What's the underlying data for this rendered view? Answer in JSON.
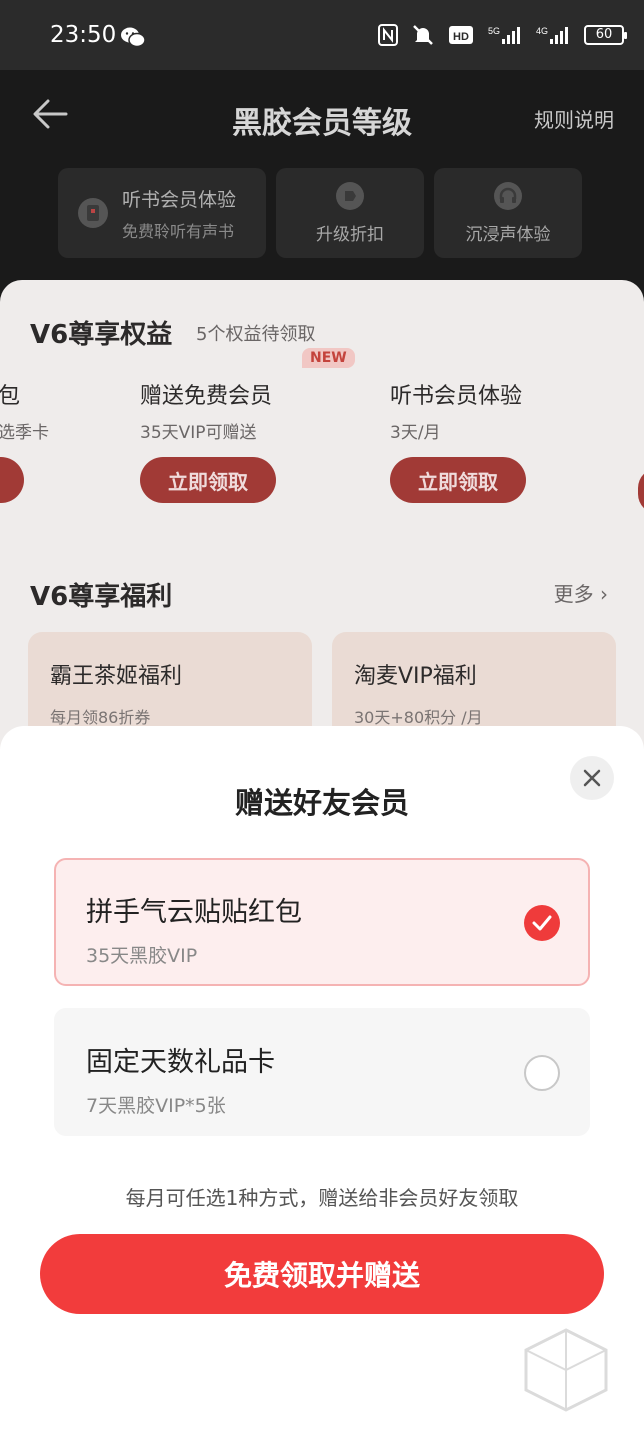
{
  "status_bar": {
    "time": "23:50",
    "battery": "60",
    "icons": [
      "wechat-icon",
      "nfc-icon",
      "mute-icon",
      "hd-icon",
      "5g-signal-icon",
      "4g-signal-icon",
      "battery-icon"
    ]
  },
  "header": {
    "title": "黑胶会员等级",
    "rules_label": "规则说明",
    "tabs": [
      {
        "label": "听书会员体验",
        "sub": "免费聆听有声书",
        "icon": "book-icon"
      },
      {
        "label": "升级折扣",
        "icon": "tag-icon"
      },
      {
        "label": "沉浸声体验",
        "icon": "headphones-icon"
      }
    ]
  },
  "rights": {
    "title": "V6尊享权益",
    "subtitle": "5个权益待领取",
    "cards": [
      {
        "title": "包",
        "sub": "选季卡"
      },
      {
        "title": "赠送免费会员",
        "sub": "35天VIP可赠送",
        "button": "立即领取",
        "badge": "NEW"
      },
      {
        "title": "听书会员体验",
        "sub": "3天/月",
        "button": "立即领取"
      }
    ]
  },
  "welfare": {
    "title": "V6尊享福利",
    "more_label": "更多",
    "cards": [
      {
        "title": "霸王茶姬福利",
        "sub": "每月领86折券"
      },
      {
        "title": "淘麦VIP福利",
        "sub": "30天+80积分 /月"
      }
    ]
  },
  "sheet": {
    "title": "赠送好友会员",
    "options": [
      {
        "title": "拼手气云贴贴红包",
        "sub": "35天黑胶VIP",
        "selected": true
      },
      {
        "title": "固定天数礼品卡",
        "sub": "7天黑胶VIP*5张",
        "selected": false
      }
    ],
    "hint": "每月可任选1种方式，赠送给非会员好友领取",
    "button_label": "免费领取并赠送"
  },
  "colors": {
    "accent": "#f23c3c",
    "selected_bg": "#fdeeee",
    "selected_border": "#f5b3b3"
  }
}
